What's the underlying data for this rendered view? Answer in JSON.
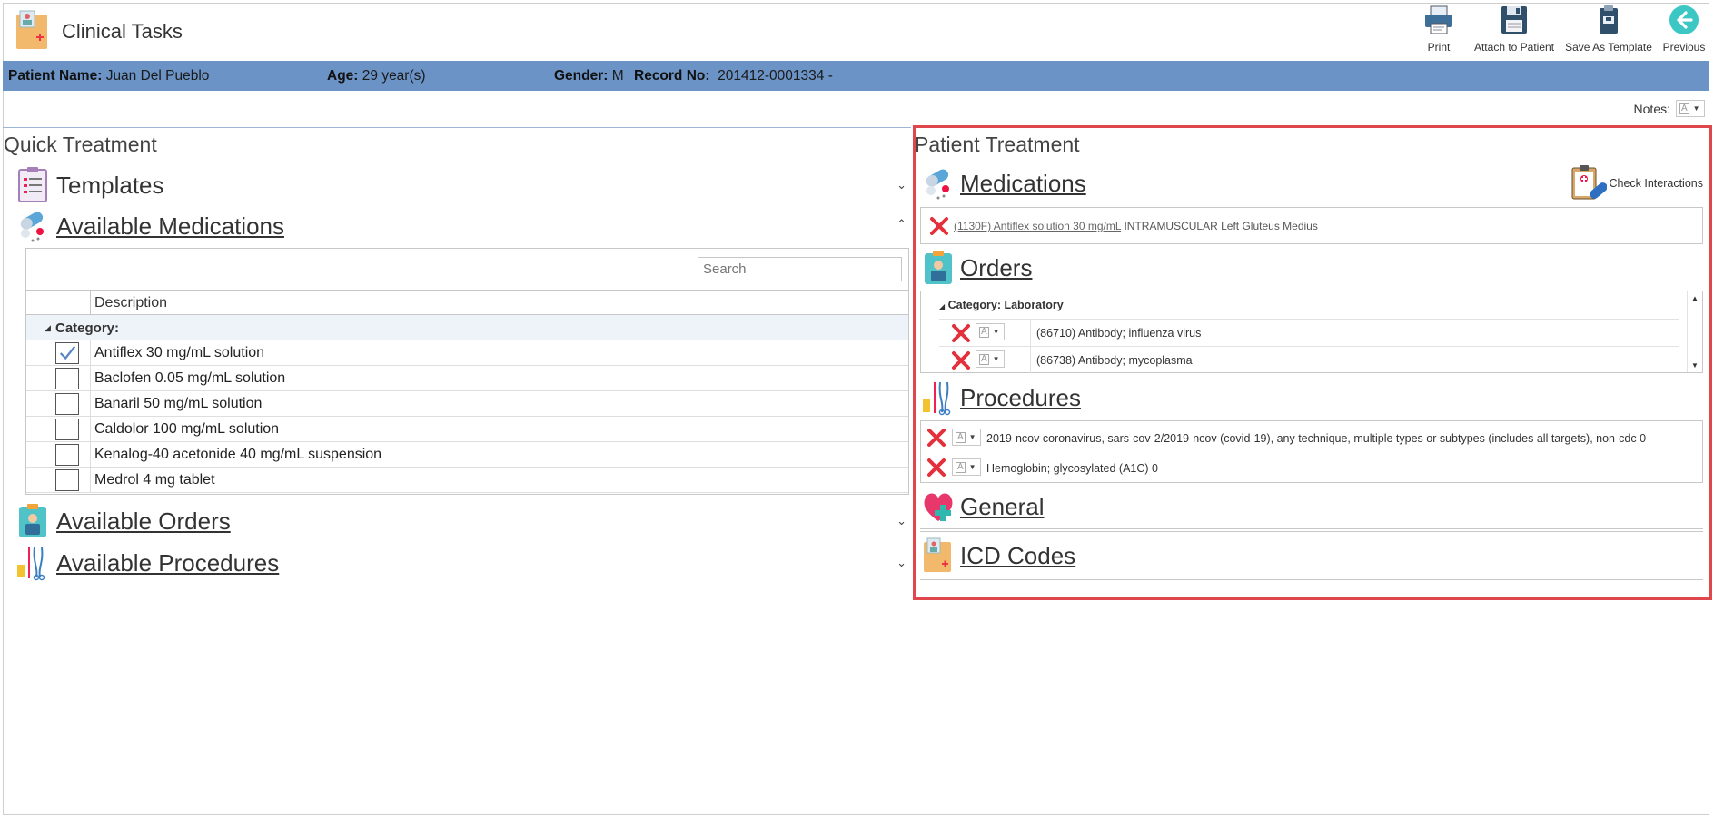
{
  "app": {
    "title": "Clinical Tasks"
  },
  "toolbar": {
    "print": "Print",
    "attach": "Attach to Patient",
    "save_template": "Save As Template",
    "previous": "Previous"
  },
  "patient": {
    "name_label": "Patient Name:",
    "name": "Juan Del Pueblo",
    "age_label": "Age:",
    "age": "29 year(s)",
    "gender_label": "Gender:",
    "gender": "M",
    "record_label": "Record No:",
    "record": "201412-0001334 -"
  },
  "notes": {
    "label": "Notes:"
  },
  "quick_treatment": {
    "title": "Quick Treatment",
    "templates": "Templates",
    "available_medications": "Available Medications",
    "search_placeholder": "Search",
    "column_description": "Description",
    "category_label": "Category:",
    "medications": [
      {
        "label": "Antiflex 30 mg/mL solution",
        "checked": true
      },
      {
        "label": "Baclofen 0.05 mg/mL solution",
        "checked": false
      },
      {
        "label": "Banaril 50 mg/mL solution",
        "checked": false
      },
      {
        "label": "Caldolor 100 mg/mL solution",
        "checked": false
      },
      {
        "label": "Kenalog-40 acetonide 40 mg/mL suspension",
        "checked": false
      },
      {
        "label": "Medrol 4 mg tablet",
        "checked": false
      }
    ],
    "available_orders": "Available Orders",
    "available_procedures": "Available Procedures"
  },
  "patient_treatment": {
    "title": "Patient Treatment",
    "medications_title": "Medications",
    "check_interactions": "Check Interactions",
    "medication_entry": {
      "link": "(1130F) Antiflex solution 30 mg/mL",
      "detail": "INTRAMUSCULAR Left Gluteus Medius"
    },
    "orders_title": "Orders",
    "orders_category": "Category: Laboratory",
    "orders": [
      "(86710) Antibody; influenza virus",
      "(86738) Antibody; mycoplasma"
    ],
    "procedures_title": "Procedures",
    "procedures": [
      "2019-ncov coronavirus, sars-cov-2/2019-ncov (covid-19), any technique, multiple types or subtypes (includes all targets), non-cdc 0",
      "Hemoglobin; glycosylated (A1C) 0"
    ],
    "general_title": "General",
    "icd_title": "ICD Codes"
  },
  "colors": {
    "patient_bar": "#6b93c6",
    "highlight_border": "#e0474c",
    "delete_red": "#e2313c"
  }
}
